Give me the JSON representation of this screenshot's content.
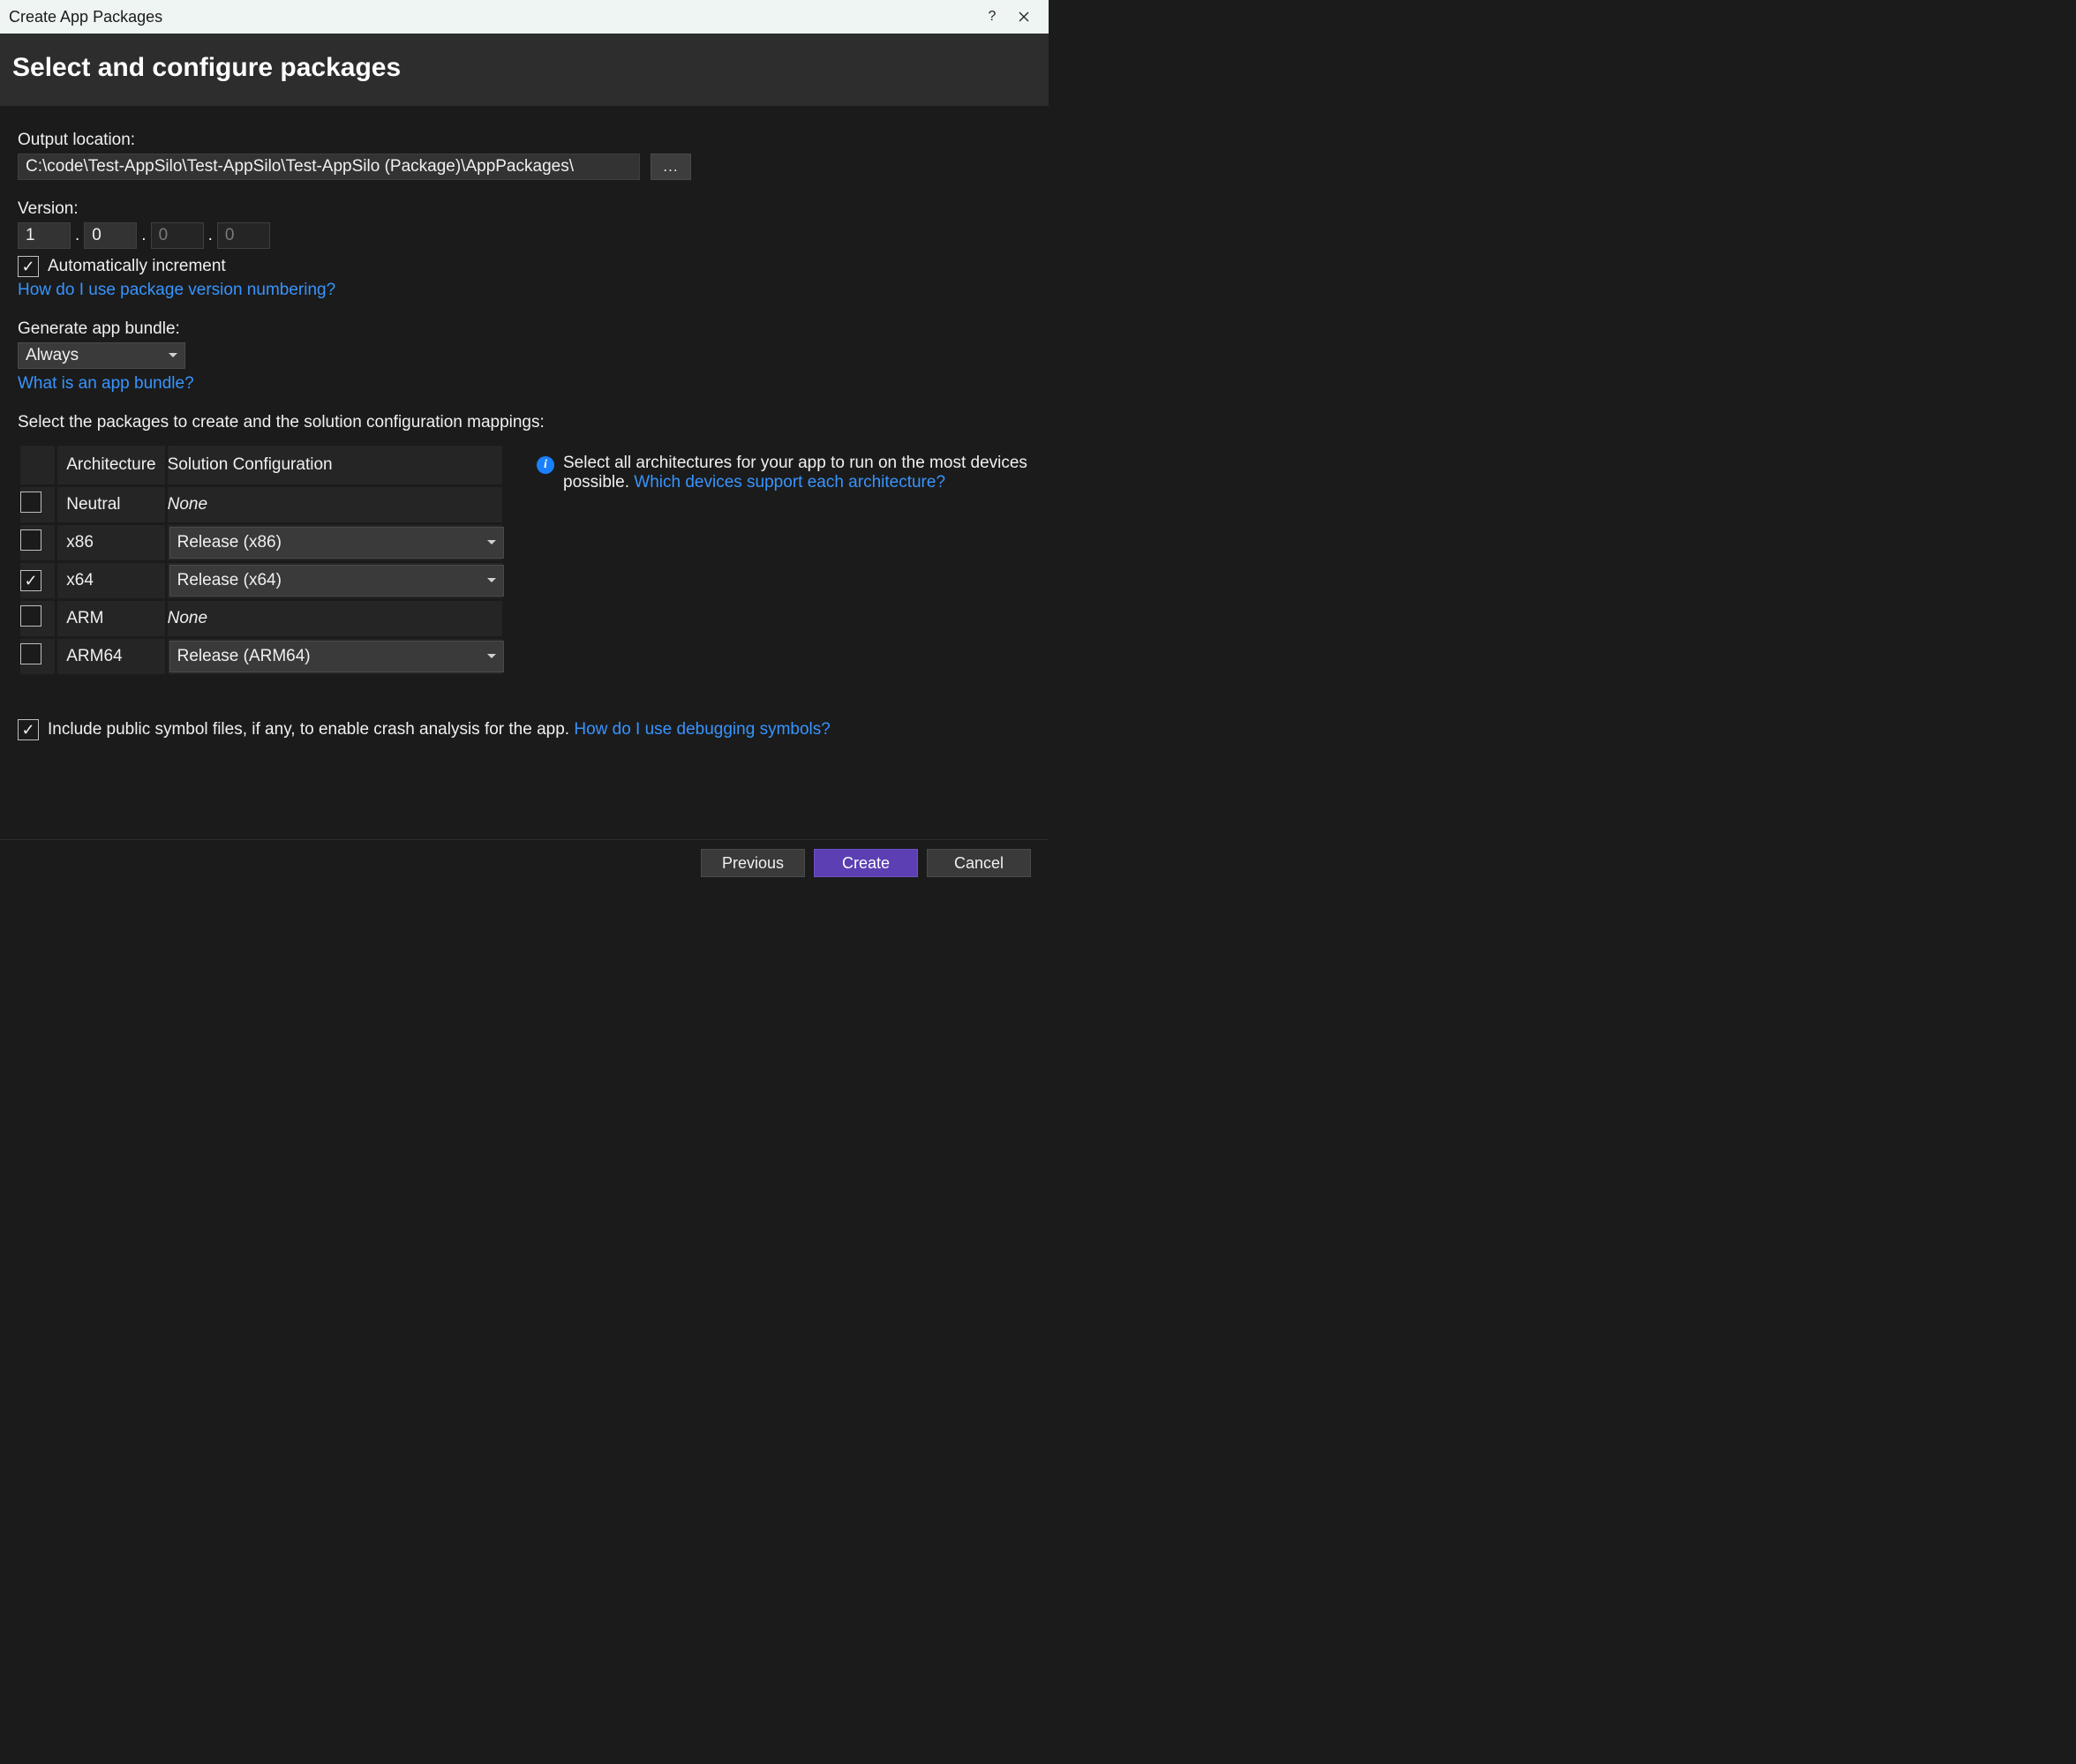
{
  "window": {
    "title": "Create App Packages",
    "help": "?",
    "close": "✕"
  },
  "header": {
    "title": "Select and configure packages"
  },
  "output": {
    "label": "Output location:",
    "value": "C:\\code\\Test-AppSilo\\Test-AppSilo\\Test-AppSilo (Package)\\AppPackages\\",
    "browse": "..."
  },
  "version": {
    "label": "Version:",
    "major": "1",
    "minor": "0",
    "build": "0",
    "revision": "0",
    "auto_increment_checked": true,
    "auto_increment_label": "Automatically increment",
    "help_link": "How do I use package version numbering?"
  },
  "bundle": {
    "label": "Generate app bundle:",
    "selected": "Always",
    "help_link": "What is an app bundle?"
  },
  "packages": {
    "label": "Select the packages to create and the solution configuration mappings:",
    "columns": {
      "arch": "Architecture",
      "config": "Solution Configuration"
    },
    "rows": [
      {
        "checked": false,
        "arch": "Neutral",
        "config": "None",
        "has_dropdown": false
      },
      {
        "checked": false,
        "arch": "x86",
        "config": "Release (x86)",
        "has_dropdown": true
      },
      {
        "checked": true,
        "arch": "x64",
        "config": "Release (x64)",
        "has_dropdown": true
      },
      {
        "checked": false,
        "arch": "ARM",
        "config": "None",
        "has_dropdown": false
      },
      {
        "checked": false,
        "arch": "ARM64",
        "config": "Release (ARM64)",
        "has_dropdown": true
      }
    ],
    "info_text_1": "Select all architectures for your app to run on the most devices possible. ",
    "info_link": "Which devices support each architecture?"
  },
  "symbols": {
    "checked": true,
    "label": "Include public symbol files, if any, to enable crash analysis for the app. ",
    "help_link": "How do I use debugging symbols?"
  },
  "footer": {
    "previous": "Previous",
    "create": "Create",
    "cancel": "Cancel"
  }
}
